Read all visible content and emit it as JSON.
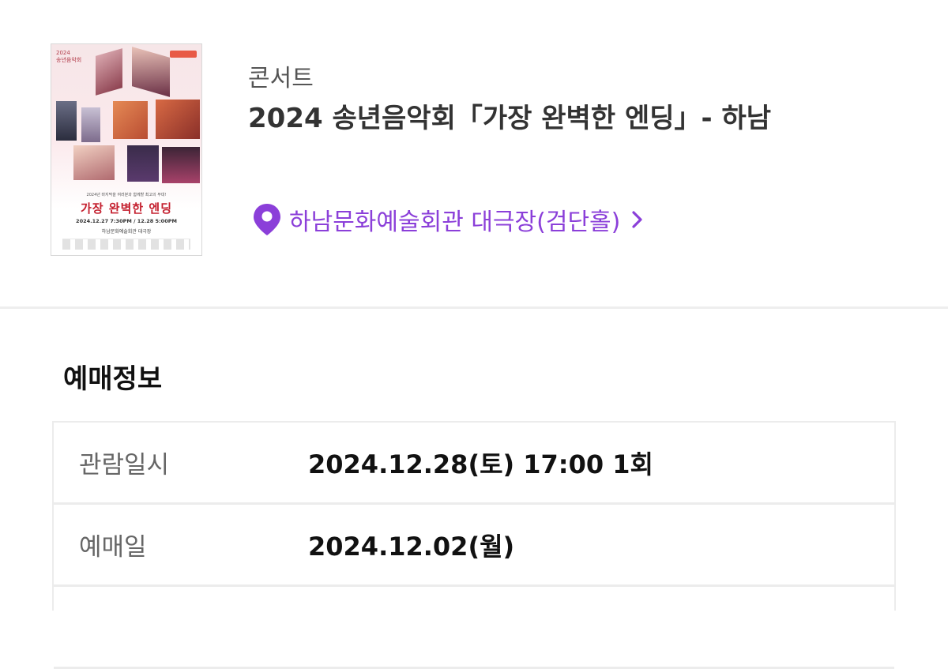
{
  "event": {
    "category": "콘서트",
    "title": "2024 송년음악회「가장 완벽한 엔딩」- 하남",
    "venue": "하남문화예술회관 대극장(검단홀)"
  },
  "poster": {
    "year": "2024",
    "series": "송년음악회",
    "subtitle": "2024년 마지막을 여러분과 함께할 최고의 무대!",
    "title": "가장 완벽한 엔딩",
    "dates": "2024.12.27 7:30PM / 12.28 5:00PM",
    "place": "하남문화예술회관 대극장"
  },
  "icons": {
    "venue": "location-pin-icon",
    "venue_link": "chevron-right-icon"
  },
  "colors": {
    "accent": "#8b3fd9",
    "poster_title": "#c4202f"
  },
  "booking_info": {
    "heading": "예매정보",
    "rows": [
      {
        "label": "관람일시",
        "value": "2024.12.28(토) 17:00 1회"
      },
      {
        "label": "예매일",
        "value": "2024.12.02(월)"
      },
      {
        "label": "",
        "value": ""
      }
    ]
  }
}
